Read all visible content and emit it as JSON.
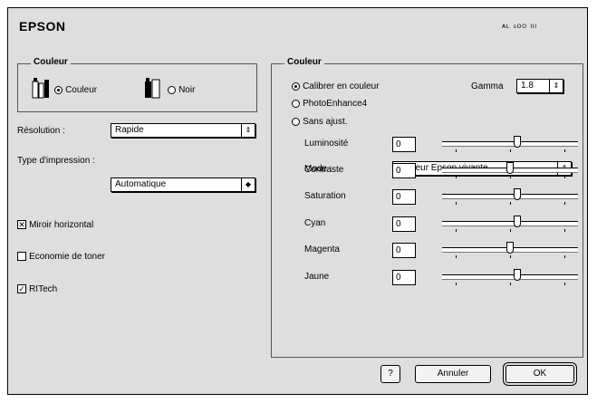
{
  "header": {
    "title": "EPSON",
    "version": "ᴬᴸ ˢᴼᴼ  ᴵᴵᴵ"
  },
  "left_group": {
    "legend": "Couleur",
    "options": [
      {
        "label": "Couleur",
        "selected": true,
        "icon": "color-ink-cartridge-icon"
      },
      {
        "label": "Noir",
        "selected": false,
        "icon": "black-ink-cartridge-icon"
      }
    ]
  },
  "resolution": {
    "label": "Résolution :",
    "value": "Rapide"
  },
  "printer_type": {
    "label": "Type d'impression :",
    "value": "Automatique"
  },
  "checkboxes": [
    {
      "label": "Miroir horizontal",
      "checked": true
    },
    {
      "label": "Economie de toner",
      "checked": false
    },
    {
      "label": "RITech",
      "checked": true
    }
  ],
  "right_group": {
    "legend": "Couleur",
    "modes": [
      {
        "label": "Calibrer en couleur",
        "selected": true
      },
      {
        "label": "PhotoEnhance4",
        "selected": false
      },
      {
        "label": "Sans ajust.",
        "selected": false
      }
    ],
    "gamma": {
      "label": "Gamma",
      "value": "1.8"
    },
    "mode": {
      "label": "Mode :",
      "value": "Couleur Epson vivante"
    },
    "sliders": [
      {
        "label": "Luminosité",
        "value": "0",
        "level": 0.55
      },
      {
        "label": "Contraste",
        "value": "0",
        "level": 0.5
      },
      {
        "label": "Saturation",
        "value": "0",
        "level": 0.55
      },
      {
        "label": "Cyan",
        "value": "0",
        "level": 0.55
      },
      {
        "label": "Magenta",
        "value": "0",
        "level": 0.5
      },
      {
        "label": "Jaune",
        "value": "0",
        "level": 0.55
      }
    ]
  },
  "buttons": {
    "help": "?",
    "cancel": "Annuler",
    "ok": "OK"
  },
  "colors": {
    "window_bg": "#dedede",
    "field_bg": "#ffffff",
    "border": "#000000"
  }
}
